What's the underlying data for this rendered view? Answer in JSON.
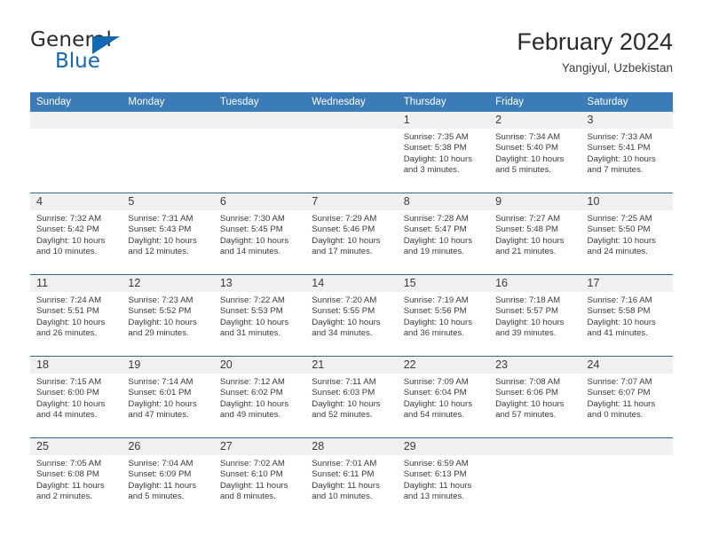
{
  "brand": {
    "name_top": "General",
    "name_bottom": "Blue",
    "triangle_color": "#1268b3",
    "accent_color": "#1268b3"
  },
  "header": {
    "title": "February 2024",
    "location": "Yangiyul, Uzbekistan"
  },
  "theme": {
    "header_bg": "#3b7cb8",
    "row_divider": "#2b6ca8",
    "daynum_bg": "#f0f0f0",
    "text": "#3a3a3a"
  },
  "weekday_headers": [
    "Sunday",
    "Monday",
    "Tuesday",
    "Wednesday",
    "Thursday",
    "Friday",
    "Saturday"
  ],
  "weeks": [
    [
      {
        "day": "",
        "sunrise": "",
        "sunset": "",
        "daylight_1": "",
        "daylight_2": ""
      },
      {
        "day": "",
        "sunrise": "",
        "sunset": "",
        "daylight_1": "",
        "daylight_2": ""
      },
      {
        "day": "",
        "sunrise": "",
        "sunset": "",
        "daylight_1": "",
        "daylight_2": ""
      },
      {
        "day": "",
        "sunrise": "",
        "sunset": "",
        "daylight_1": "",
        "daylight_2": ""
      },
      {
        "day": "1",
        "sunrise": "Sunrise: 7:35 AM",
        "sunset": "Sunset: 5:38 PM",
        "daylight_1": "Daylight: 10 hours",
        "daylight_2": "and 3 minutes."
      },
      {
        "day": "2",
        "sunrise": "Sunrise: 7:34 AM",
        "sunset": "Sunset: 5:40 PM",
        "daylight_1": "Daylight: 10 hours",
        "daylight_2": "and 5 minutes."
      },
      {
        "day": "3",
        "sunrise": "Sunrise: 7:33 AM",
        "sunset": "Sunset: 5:41 PM",
        "daylight_1": "Daylight: 10 hours",
        "daylight_2": "and 7 minutes."
      }
    ],
    [
      {
        "day": "4",
        "sunrise": "Sunrise: 7:32 AM",
        "sunset": "Sunset: 5:42 PM",
        "daylight_1": "Daylight: 10 hours",
        "daylight_2": "and 10 minutes."
      },
      {
        "day": "5",
        "sunrise": "Sunrise: 7:31 AM",
        "sunset": "Sunset: 5:43 PM",
        "daylight_1": "Daylight: 10 hours",
        "daylight_2": "and 12 minutes."
      },
      {
        "day": "6",
        "sunrise": "Sunrise: 7:30 AM",
        "sunset": "Sunset: 5:45 PM",
        "daylight_1": "Daylight: 10 hours",
        "daylight_2": "and 14 minutes."
      },
      {
        "day": "7",
        "sunrise": "Sunrise: 7:29 AM",
        "sunset": "Sunset: 5:46 PM",
        "daylight_1": "Daylight: 10 hours",
        "daylight_2": "and 17 minutes."
      },
      {
        "day": "8",
        "sunrise": "Sunrise: 7:28 AM",
        "sunset": "Sunset: 5:47 PM",
        "daylight_1": "Daylight: 10 hours",
        "daylight_2": "and 19 minutes."
      },
      {
        "day": "9",
        "sunrise": "Sunrise: 7:27 AM",
        "sunset": "Sunset: 5:48 PM",
        "daylight_1": "Daylight: 10 hours",
        "daylight_2": "and 21 minutes."
      },
      {
        "day": "10",
        "sunrise": "Sunrise: 7:25 AM",
        "sunset": "Sunset: 5:50 PM",
        "daylight_1": "Daylight: 10 hours",
        "daylight_2": "and 24 minutes."
      }
    ],
    [
      {
        "day": "11",
        "sunrise": "Sunrise: 7:24 AM",
        "sunset": "Sunset: 5:51 PM",
        "daylight_1": "Daylight: 10 hours",
        "daylight_2": "and 26 minutes."
      },
      {
        "day": "12",
        "sunrise": "Sunrise: 7:23 AM",
        "sunset": "Sunset: 5:52 PM",
        "daylight_1": "Daylight: 10 hours",
        "daylight_2": "and 29 minutes."
      },
      {
        "day": "13",
        "sunrise": "Sunrise: 7:22 AM",
        "sunset": "Sunset: 5:53 PM",
        "daylight_1": "Daylight: 10 hours",
        "daylight_2": "and 31 minutes."
      },
      {
        "day": "14",
        "sunrise": "Sunrise: 7:20 AM",
        "sunset": "Sunset: 5:55 PM",
        "daylight_1": "Daylight: 10 hours",
        "daylight_2": "and 34 minutes."
      },
      {
        "day": "15",
        "sunrise": "Sunrise: 7:19 AM",
        "sunset": "Sunset: 5:56 PM",
        "daylight_1": "Daylight: 10 hours",
        "daylight_2": "and 36 minutes."
      },
      {
        "day": "16",
        "sunrise": "Sunrise: 7:18 AM",
        "sunset": "Sunset: 5:57 PM",
        "daylight_1": "Daylight: 10 hours",
        "daylight_2": "and 39 minutes."
      },
      {
        "day": "17",
        "sunrise": "Sunrise: 7:16 AM",
        "sunset": "Sunset: 5:58 PM",
        "daylight_1": "Daylight: 10 hours",
        "daylight_2": "and 41 minutes."
      }
    ],
    [
      {
        "day": "18",
        "sunrise": "Sunrise: 7:15 AM",
        "sunset": "Sunset: 6:00 PM",
        "daylight_1": "Daylight: 10 hours",
        "daylight_2": "and 44 minutes."
      },
      {
        "day": "19",
        "sunrise": "Sunrise: 7:14 AM",
        "sunset": "Sunset: 6:01 PM",
        "daylight_1": "Daylight: 10 hours",
        "daylight_2": "and 47 minutes."
      },
      {
        "day": "20",
        "sunrise": "Sunrise: 7:12 AM",
        "sunset": "Sunset: 6:02 PM",
        "daylight_1": "Daylight: 10 hours",
        "daylight_2": "and 49 minutes."
      },
      {
        "day": "21",
        "sunrise": "Sunrise: 7:11 AM",
        "sunset": "Sunset: 6:03 PM",
        "daylight_1": "Daylight: 10 hours",
        "daylight_2": "and 52 minutes."
      },
      {
        "day": "22",
        "sunrise": "Sunrise: 7:09 AM",
        "sunset": "Sunset: 6:04 PM",
        "daylight_1": "Daylight: 10 hours",
        "daylight_2": "and 54 minutes."
      },
      {
        "day": "23",
        "sunrise": "Sunrise: 7:08 AM",
        "sunset": "Sunset: 6:06 PM",
        "daylight_1": "Daylight: 10 hours",
        "daylight_2": "and 57 minutes."
      },
      {
        "day": "24",
        "sunrise": "Sunrise: 7:07 AM",
        "sunset": "Sunset: 6:07 PM",
        "daylight_1": "Daylight: 11 hours",
        "daylight_2": "and 0 minutes."
      }
    ],
    [
      {
        "day": "25",
        "sunrise": "Sunrise: 7:05 AM",
        "sunset": "Sunset: 6:08 PM",
        "daylight_1": "Daylight: 11 hours",
        "daylight_2": "and 2 minutes."
      },
      {
        "day": "26",
        "sunrise": "Sunrise: 7:04 AM",
        "sunset": "Sunset: 6:09 PM",
        "daylight_1": "Daylight: 11 hours",
        "daylight_2": "and 5 minutes."
      },
      {
        "day": "27",
        "sunrise": "Sunrise: 7:02 AM",
        "sunset": "Sunset: 6:10 PM",
        "daylight_1": "Daylight: 11 hours",
        "daylight_2": "and 8 minutes."
      },
      {
        "day": "28",
        "sunrise": "Sunrise: 7:01 AM",
        "sunset": "Sunset: 6:11 PM",
        "daylight_1": "Daylight: 11 hours",
        "daylight_2": "and 10 minutes."
      },
      {
        "day": "29",
        "sunrise": "Sunrise: 6:59 AM",
        "sunset": "Sunset: 6:13 PM",
        "daylight_1": "Daylight: 11 hours",
        "daylight_2": "and 13 minutes."
      },
      {
        "day": "",
        "sunrise": "",
        "sunset": "",
        "daylight_1": "",
        "daylight_2": ""
      },
      {
        "day": "",
        "sunrise": "",
        "sunset": "",
        "daylight_1": "",
        "daylight_2": ""
      }
    ]
  ]
}
